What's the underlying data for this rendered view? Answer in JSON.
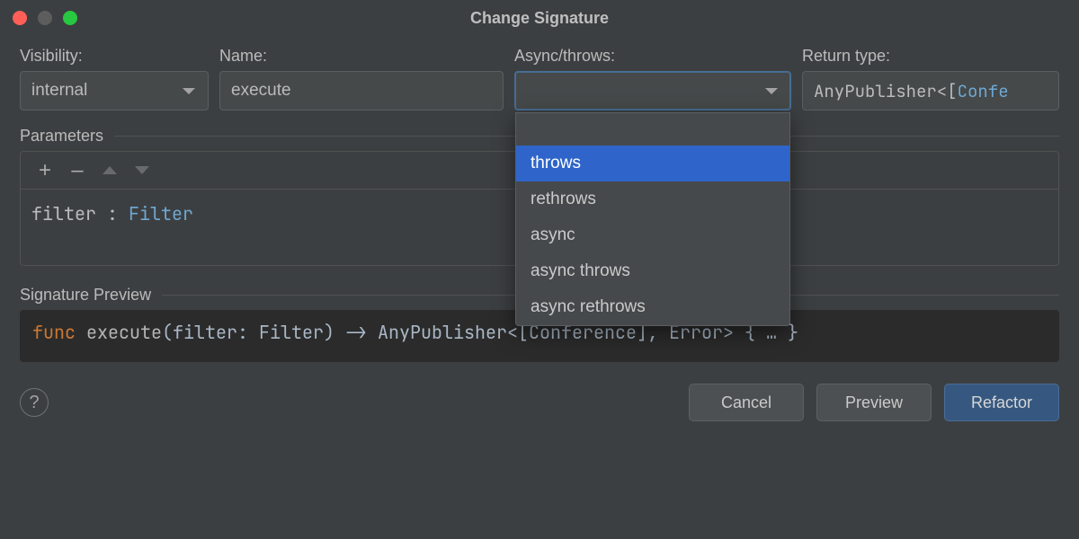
{
  "title": "Change Signature",
  "labels": {
    "visibility": "Visibility:",
    "name": "Name:",
    "async": "Async/throws:",
    "return": "Return type:",
    "parameters": "Parameters",
    "preview": "Signature Preview"
  },
  "visibility": {
    "value": "internal"
  },
  "name": {
    "value": "execute"
  },
  "async": {
    "value": "",
    "options": [
      "",
      "throws",
      "rethrows",
      "async",
      "async throws",
      "async rethrows"
    ],
    "highlighted": "throws"
  },
  "returnType": {
    "prefix": "AnyPublisher<[",
    "ident": "Confe"
  },
  "parameters": [
    {
      "name": "filter",
      "sep": " : ",
      "type": "Filter"
    }
  ],
  "previewTokens": {
    "kw": "func",
    "fn": "execute",
    "open": "(",
    "param": "filter",
    "colon": ": ",
    "ptype": "Filter",
    "close": ")",
    "arrow": " -> ",
    "rtype": "AnyPublisher<[Conference], Error>",
    "body": " { … }"
  },
  "buttons": {
    "cancel": "Cancel",
    "preview": "Preview",
    "refactor": "Refactor",
    "help": "?"
  }
}
